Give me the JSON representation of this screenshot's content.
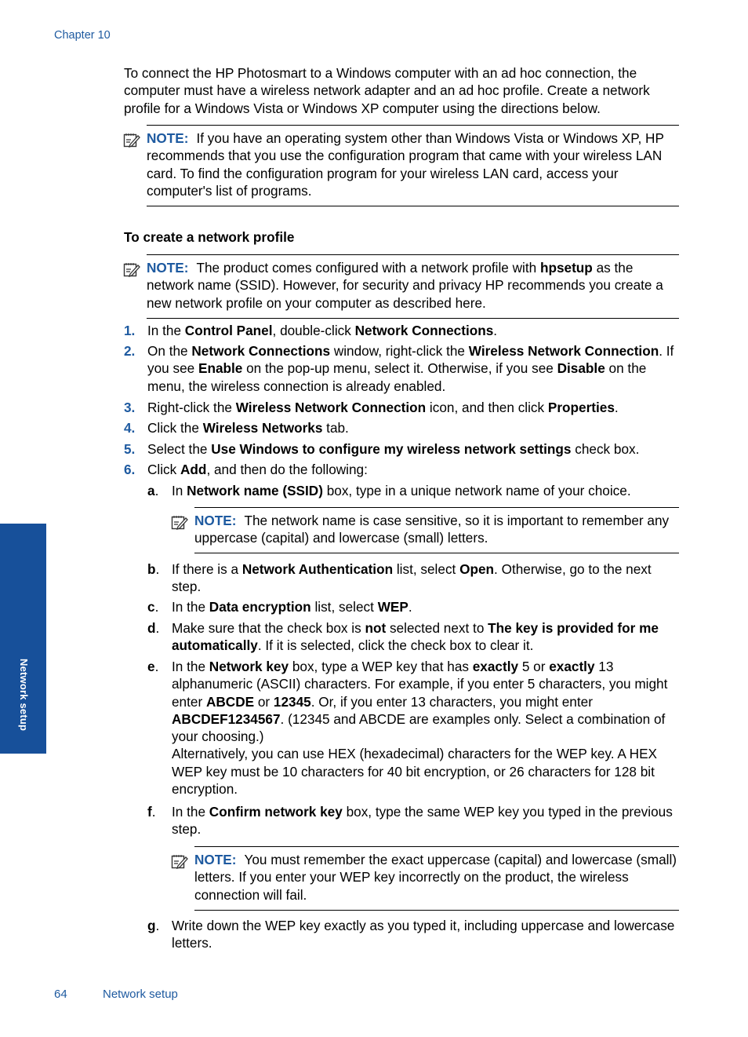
{
  "header": {
    "chapter": "Chapter 10"
  },
  "side_tab": {
    "label": "Network setup",
    "color": "#17509a"
  },
  "footer": {
    "page_number": "64",
    "section": "Network setup"
  },
  "colors": {
    "accent": "#1e5aa0",
    "text": "#000000"
  },
  "note_label": "NOTE:",
  "note_icon": "note-pencil-icon",
  "intro": [
    {
      "t": "To connect the HP Photosmart to a Windows computer with an ad hoc connection, the computer must have a wireless network adapter and an ad hoc profile. Create a network profile for a Windows Vista or Windows XP computer using the directions below.",
      "b": false
    }
  ],
  "notes": [
    [
      {
        "t": "If you have an operating system other than Windows Vista or Windows XP, HP recommends that you use the configuration program that came with your wireless LAN card. To find the configuration program for your wireless LAN card, access your computer's list of programs.",
        "b": false
      }
    ],
    [
      {
        "t": "The product comes configured with a network profile with ",
        "b": false
      },
      {
        "t": "hpsetup",
        "b": true
      },
      {
        "t": " as the network name (SSID). However, for security and privacy HP recommends you create a new network profile on your computer as described here.",
        "b": false
      }
    ],
    [
      {
        "t": "The network name is case sensitive, so it is important to remember any uppercase (capital) and lowercase (small) letters.",
        "b": false
      }
    ],
    [
      {
        "t": "You must remember the exact uppercase (capital) and lowercase (small) letters. If you enter your WEP key incorrectly on the product, the wireless connection will fail.",
        "b": false
      }
    ]
  ],
  "heading": "To create a network profile",
  "steps": [
    {
      "num": "1.",
      "text": [
        {
          "t": "In the ",
          "b": false
        },
        {
          "t": "Control Panel",
          "b": true
        },
        {
          "t": ", double-click ",
          "b": false
        },
        {
          "t": "Network Connections",
          "b": true
        },
        {
          "t": ".",
          "b": false
        }
      ]
    },
    {
      "num": "2.",
      "text": [
        {
          "t": "On the ",
          "b": false
        },
        {
          "t": "Network Connections",
          "b": true
        },
        {
          "t": " window, right-click the ",
          "b": false
        },
        {
          "t": "Wireless Network Connection",
          "b": true
        },
        {
          "t": ". If you see ",
          "b": false
        },
        {
          "t": "Enable",
          "b": true
        },
        {
          "t": " on the pop-up menu, select it. Otherwise, if you see ",
          "b": false
        },
        {
          "t": "Disable",
          "b": true
        },
        {
          "t": " on the menu, the wireless connection is already enabled.",
          "b": false
        }
      ]
    },
    {
      "num": "3.",
      "text": [
        {
          "t": "Right-click the ",
          "b": false
        },
        {
          "t": "Wireless Network Connection",
          "b": true
        },
        {
          "t": " icon, and then click ",
          "b": false
        },
        {
          "t": "Properties",
          "b": true
        },
        {
          "t": ".",
          "b": false
        }
      ]
    },
    {
      "num": "4.",
      "text": [
        {
          "t": "Click the ",
          "b": false
        },
        {
          "t": "Wireless Networks",
          "b": true
        },
        {
          "t": " tab.",
          "b": false
        }
      ]
    },
    {
      "num": "5.",
      "text": [
        {
          "t": "Select the ",
          "b": false
        },
        {
          "t": "Use Windows to configure my wireless network settings",
          "b": true
        },
        {
          "t": " check box.",
          "b": false
        }
      ]
    },
    {
      "num": "6.",
      "text": [
        {
          "t": "Click ",
          "b": false
        },
        {
          "t": "Add",
          "b": true
        },
        {
          "t": ", and then do the following:",
          "b": false
        }
      ]
    }
  ],
  "substeps": [
    {
      "letter": "a",
      "text": [
        {
          "t": "In ",
          "b": false
        },
        {
          "t": "Network name (SSID)",
          "b": true
        },
        {
          "t": " box, type in a unique network name of your choice.",
          "b": false
        }
      ]
    },
    {
      "letter": "b",
      "text": [
        {
          "t": "If there is a ",
          "b": false
        },
        {
          "t": "Network Authentication",
          "b": true
        },
        {
          "t": " list, select ",
          "b": false
        },
        {
          "t": "Open",
          "b": true
        },
        {
          "t": ". Otherwise, go to the next step.",
          "b": false
        }
      ]
    },
    {
      "letter": "c",
      "text": [
        {
          "t": "In the ",
          "b": false
        },
        {
          "t": "Data encryption",
          "b": true
        },
        {
          "t": " list, select ",
          "b": false
        },
        {
          "t": "WEP",
          "b": true
        },
        {
          "t": ".",
          "b": false
        }
      ]
    },
    {
      "letter": "d",
      "text": [
        {
          "t": "Make sure that the check box is ",
          "b": false
        },
        {
          "t": "not",
          "b": true
        },
        {
          "t": " selected next to ",
          "b": false
        },
        {
          "t": "The key is provided for me automatically",
          "b": true
        },
        {
          "t": ". If it is selected, click the check box to clear it.",
          "b": false
        }
      ]
    },
    {
      "letter": "e",
      "text": [
        {
          "t": "In the ",
          "b": false
        },
        {
          "t": "Network key",
          "b": true
        },
        {
          "t": " box, type a WEP key that has ",
          "b": false
        },
        {
          "t": "exactly",
          "b": true
        },
        {
          "t": " 5 or ",
          "b": false
        },
        {
          "t": "exactly",
          "b": true
        },
        {
          "t": " 13 alphanumeric (ASCII) characters. For example, if you enter 5 characters, you might enter ",
          "b": false
        },
        {
          "t": "ABCDE",
          "b": true
        },
        {
          "t": " or ",
          "b": false
        },
        {
          "t": "12345",
          "b": true
        },
        {
          "t": ". Or, if you enter 13 characters, you might enter ",
          "b": false
        },
        {
          "t": "ABCDEF1234567",
          "b": true
        },
        {
          "t": ". (12345 and ABCDE are examples only. Select a combination of your choosing.)",
          "b": false
        },
        {
          "t": "\n",
          "b": false
        },
        {
          "t": "Alternatively, you can use HEX (hexadecimal) characters for the WEP key. A HEX WEP key must be 10 characters for 40 bit encryption, or 26 characters for 128 bit encryption.",
          "b": false
        }
      ]
    },
    {
      "letter": "f",
      "text": [
        {
          "t": "In the ",
          "b": false
        },
        {
          "t": "Confirm network key",
          "b": true
        },
        {
          "t": " box, type the same WEP key you typed in the previous step.",
          "b": false
        }
      ]
    },
    {
      "letter": "g",
      "text": [
        {
          "t": "Write down the WEP key exactly as you typed it, including uppercase and lowercase letters.",
          "b": false
        }
      ]
    }
  ]
}
